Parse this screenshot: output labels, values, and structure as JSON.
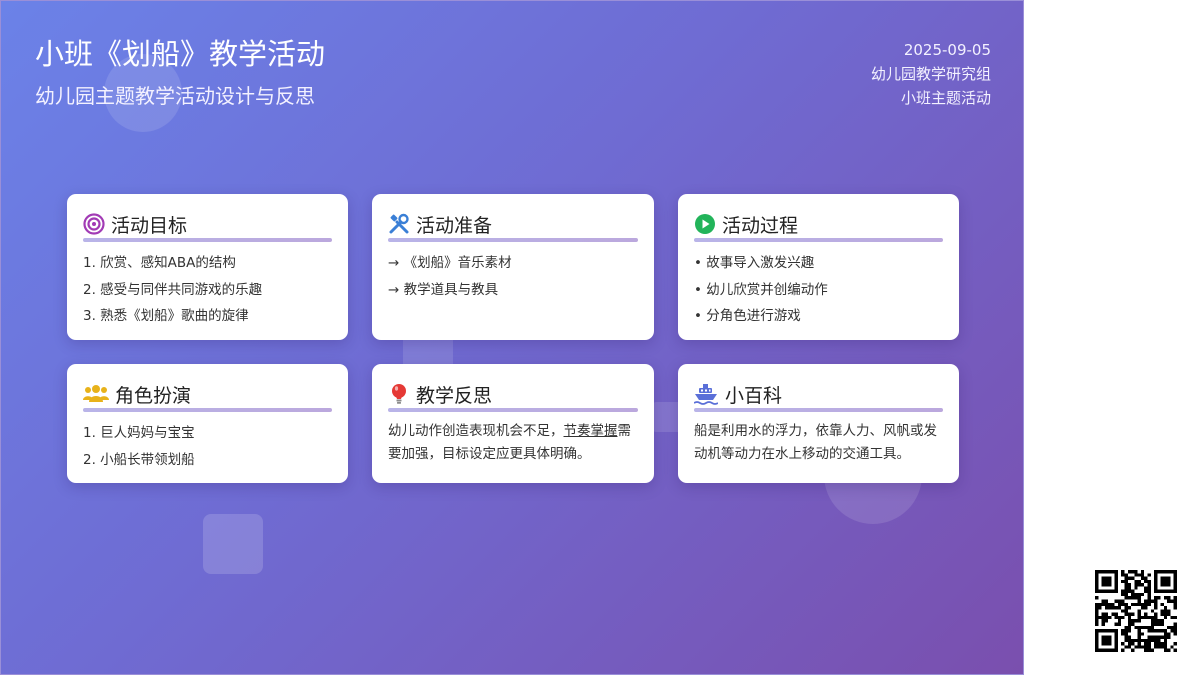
{
  "header": {
    "title": "小班《划船》教学活动",
    "subtitle": "幼儿园主题教学活动设计与反思",
    "date": "2025-09-05",
    "group": "幼儿园教学研究组",
    "category": "小班主题活动"
  },
  "cards": {
    "goal": {
      "title": "活动目标",
      "icon": "target-icon",
      "items": [
        "1. 欣赏、感知ABA的结构",
        "2. 感受与同伴共同游戏的乐趣",
        "3. 熟悉《划船》歌曲的旋律"
      ]
    },
    "prep": {
      "title": "活动准备",
      "icon": "tools-icon",
      "items": [
        "→ 《划船》音乐素材",
        "→ 教学道具与教具"
      ]
    },
    "process": {
      "title": "活动过程",
      "icon": "play-icon",
      "items": [
        "• 故事导入激发兴趣",
        "• 幼儿欣赏并创编动作",
        "• 分角色进行游戏"
      ]
    },
    "role": {
      "title": "角色扮演",
      "icon": "people-icon",
      "items": [
        "1. 巨人妈妈与宝宝",
        "2. 小船长带领划船"
      ]
    },
    "reflect": {
      "title": "教学反思",
      "icon": "lightbulb-icon",
      "text_before": "幼儿动作创造表现机会不足，",
      "text_highlight": "节奏掌握",
      "text_after": "需要加强，目标设定应更具体明确。"
    },
    "wiki": {
      "title": "小百科",
      "icon": "ship-icon",
      "text": "船是利用水的浮力，依靠人力、风帆或发动机等动力在水上移动的交通工具。"
    }
  },
  "colors": {
    "gradient_start": "#6b82e8",
    "gradient_end": "#7a4fae",
    "card_bar": "#b9b4e8",
    "target_icon": "#a23bb5",
    "tools_icon": "#3a7fd6",
    "play_icon": "#22b45a",
    "people_icon": "#e8b21a",
    "lightbulb_icon": "#e53935",
    "ship_icon": "#5a6fd8"
  },
  "qr": {
    "icon": "qr-code-icon"
  }
}
